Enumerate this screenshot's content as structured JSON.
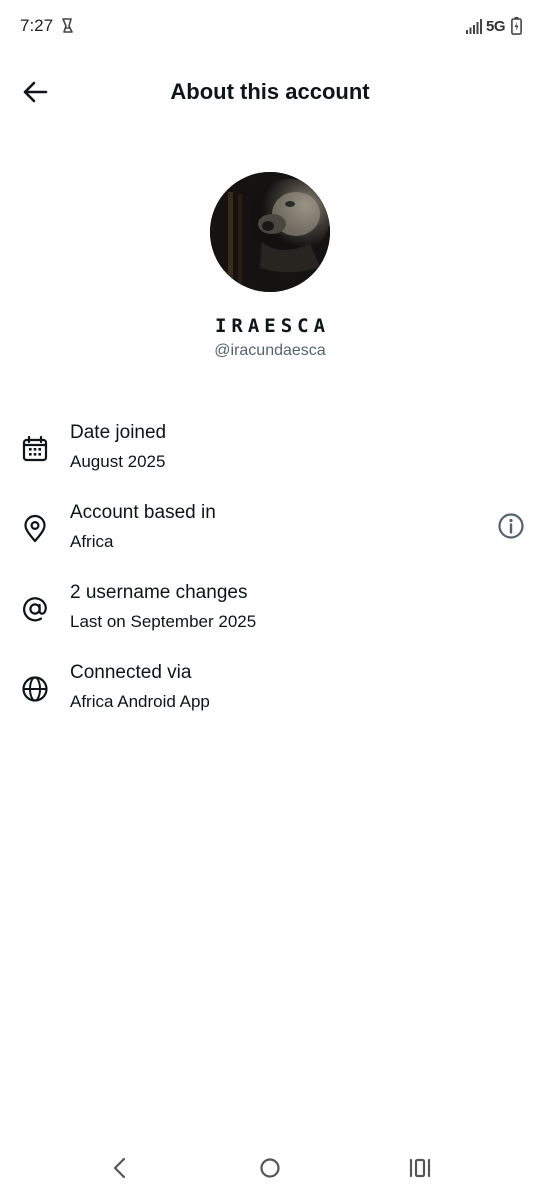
{
  "status_bar": {
    "time": "7:27",
    "network": "5G",
    "left_icon": "notification-icon",
    "signal_icon": "signal-icon",
    "battery_icon": "battery-icon"
  },
  "header": {
    "title": "About this account",
    "back_icon": "back-arrow-icon"
  },
  "profile": {
    "display_name": "IRAESCA",
    "handle": "@iracundaesca"
  },
  "info": [
    {
      "icon": "calendar-icon",
      "title": "Date joined",
      "subtitle": "August 2025"
    },
    {
      "icon": "location-pin-icon",
      "title": "Account based in",
      "subtitle": "Africa",
      "action_icon": "info-circle-icon"
    },
    {
      "icon": "at-sign-icon",
      "title": "2 username changes",
      "subtitle": "Last on September 2025"
    },
    {
      "icon": "globe-icon",
      "title": "Connected via",
      "subtitle": "Africa Android App"
    }
  ],
  "nav_bar": {
    "back": "nav-back-icon",
    "home": "nav-home-icon",
    "recents": "nav-recents-icon"
  },
  "colors": {
    "text": "#0f1419",
    "secondary_text": "#536471",
    "info_icon": "#536471",
    "background": "#ffffff"
  }
}
